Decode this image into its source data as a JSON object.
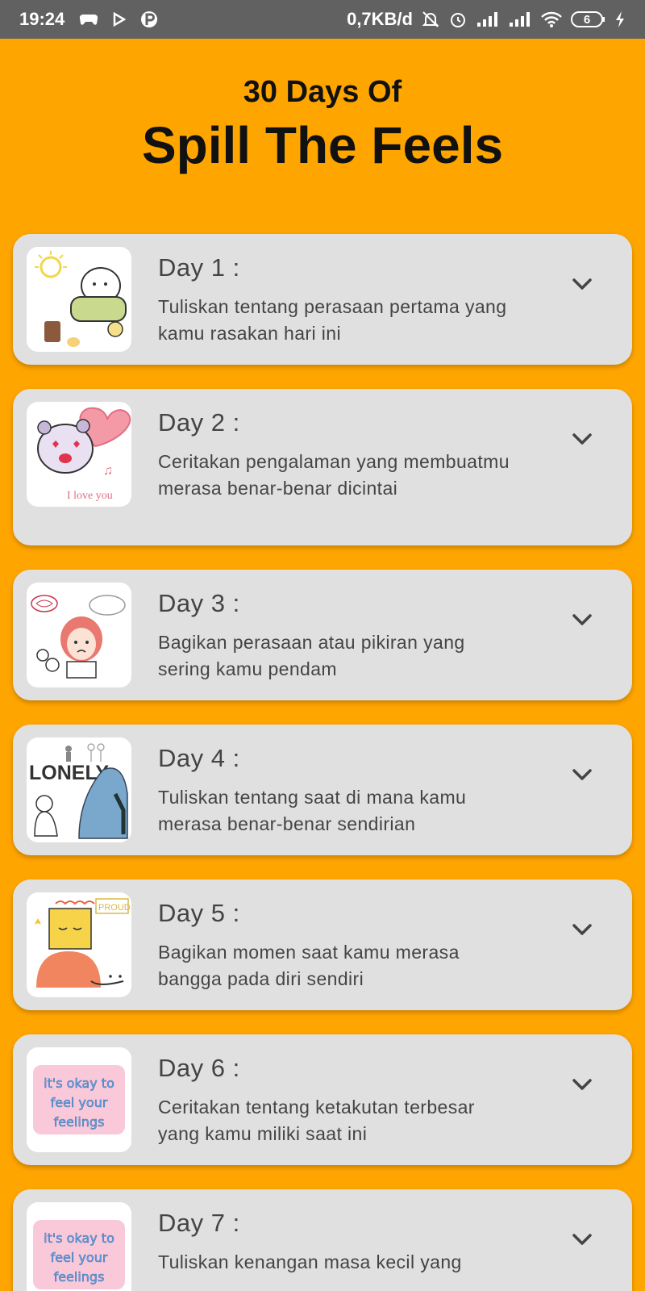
{
  "status_bar": {
    "time": "19:24",
    "net_speed": "0,7KB/d",
    "battery": "6",
    "icons": [
      "gamepad-icon",
      "play-icon",
      "p-app-icon",
      "mute-icon",
      "alarm-icon",
      "signal-icon",
      "signal-icon",
      "wifi-icon",
      "battery-icon",
      "charging-icon"
    ]
  },
  "header": {
    "subtitle": "30 Days Of",
    "title": "Spill The Feels"
  },
  "days": [
    {
      "label": "Day 1 :",
      "prompt": "Tuliskan tentang perasaan pertama yang kamu rasakan hari ini",
      "image": "morning-sun-sticker"
    },
    {
      "label": "Day 2 :",
      "prompt": "Ceritakan pengalaman yang membuatmu merasa benar-benar dicintai",
      "image": "love-hamster-sticker",
      "image_text": "I love you"
    },
    {
      "label": "Day 3 :",
      "prompt": "Bagikan perasaan atau pikiran yang sering kamu pendam",
      "image": "sad-girl-sticker"
    },
    {
      "label": "Day 4 :",
      "prompt": "Tuliskan tentang saat di mana kamu merasa benar-benar sendirian",
      "image": "lonely-sticker",
      "image_text": "LONELY"
    },
    {
      "label": "Day 5 :",
      "prompt": "Bagikan momen saat kamu merasa bangga pada diri sendiri",
      "image": "proud-sticker",
      "image_text": "PROUD"
    },
    {
      "label": "Day 6 :",
      "prompt": "Ceritakan tentang ketakutan terbesar yang kamu miliki saat ini",
      "image": "feelings-text-sticker",
      "image_text": "it's okay to feel your feelings"
    },
    {
      "label": "Day 7 :",
      "prompt": "Tuliskan kenangan masa kecil yang",
      "image": "feelings-text-sticker",
      "image_text": "it's okay to feel your feelings"
    }
  ]
}
